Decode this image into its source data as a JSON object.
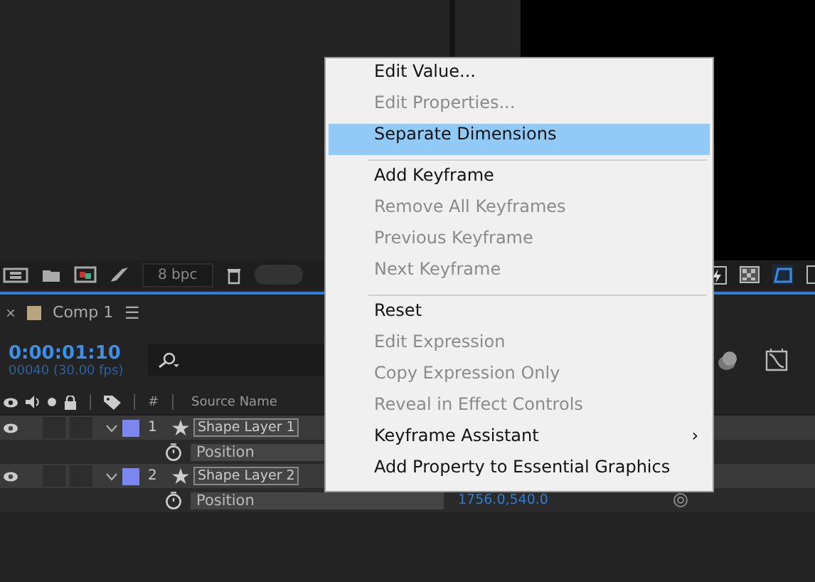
{
  "toolbar": {
    "bpc": "8 bpc",
    "toggle_on": false
  },
  "tab": {
    "close": "×",
    "title": "Comp 1",
    "color": "#b9a57d",
    "menu": "☰"
  },
  "time": {
    "timecode": "0:00:01:10",
    "frame_info": "00040 (30.00 fps)"
  },
  "columns": [
    "#",
    "Source Name"
  ],
  "layers": [
    {
      "number": "1",
      "name": "Shape Layer 1",
      "visible": true,
      "expanded": true,
      "color": "#7b87ee",
      "property": {
        "name": "Position"
      }
    },
    {
      "number": "2",
      "name": "Shape Layer 2",
      "visible": true,
      "expanded": true,
      "color": "#7b87ee",
      "property": {
        "name": "Position",
        "value": "1756.0,540.0"
      }
    }
  ],
  "context_menu": {
    "items": [
      {
        "kind": "item",
        "label": "Edit Value...",
        "disabled": false,
        "selected": false
      },
      {
        "kind": "item",
        "label": "Edit Properties...",
        "disabled": true,
        "selected": false
      },
      {
        "kind": "item",
        "label": "Separate Dimensions",
        "disabled": false,
        "selected": true
      },
      {
        "kind": "separator"
      },
      {
        "kind": "item",
        "label": "Add Keyframe",
        "disabled": false,
        "selected": false
      },
      {
        "kind": "item",
        "label": "Remove All Keyframes",
        "disabled": true,
        "selected": false
      },
      {
        "kind": "item",
        "label": "Previous Keyframe",
        "disabled": true,
        "selected": false
      },
      {
        "kind": "item",
        "label": "Next Keyframe",
        "disabled": true,
        "selected": false
      },
      {
        "kind": "separator"
      },
      {
        "kind": "item",
        "label": "Reset",
        "disabled": false,
        "selected": false
      },
      {
        "kind": "item",
        "label": "Edit Expression",
        "disabled": true,
        "selected": false
      },
      {
        "kind": "item",
        "label": "Copy Expression Only",
        "disabled": true,
        "selected": false
      },
      {
        "kind": "item",
        "label": "Reveal in Effect Controls",
        "disabled": true,
        "selected": false
      },
      {
        "kind": "item",
        "label": "Keyframe Assistant",
        "disabled": false,
        "selected": false,
        "arrow": "›"
      },
      {
        "kind": "item",
        "label": "Add Property to Essential Graphics",
        "disabled": false,
        "selected": false
      }
    ]
  }
}
